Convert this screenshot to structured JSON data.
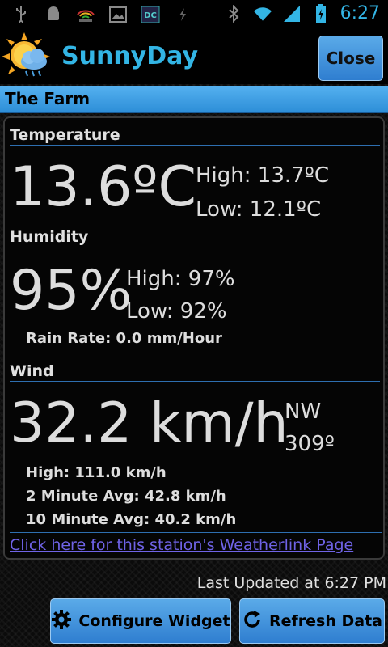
{
  "status_bar": {
    "time": "6:27"
  },
  "app": {
    "title": "SunnyDay",
    "close_label": "Close"
  },
  "station": {
    "name": "The Farm"
  },
  "temperature": {
    "heading": "Temperature",
    "value": "13.6ºC",
    "high": "High: 13.7ºC",
    "low": "Low: 12.1ºC"
  },
  "humidity": {
    "heading": "Humidity",
    "value": "95%",
    "high": "High: 97%",
    "low": "Low: 92%",
    "rain_rate": "Rain Rate: 0.0 mm/Hour"
  },
  "wind": {
    "heading": "Wind",
    "value": "32.2 km/h",
    "direction": "NW",
    "degrees": "309º",
    "high": "High: 111.0 km/h",
    "avg2": "2 Minute Avg: 42.8 km/h",
    "avg10": "10 Minute Avg: 40.2 km/h"
  },
  "link_text": "Click here for this station's Weatherlink Page",
  "last_updated": "Last Updated at 6:27 PM",
  "buttons": {
    "configure": "Configure Widget",
    "refresh": "Refresh Data"
  },
  "colors": {
    "accent": "#33b5e5",
    "button": "#3d8fdc",
    "link": "#6f63e6"
  }
}
